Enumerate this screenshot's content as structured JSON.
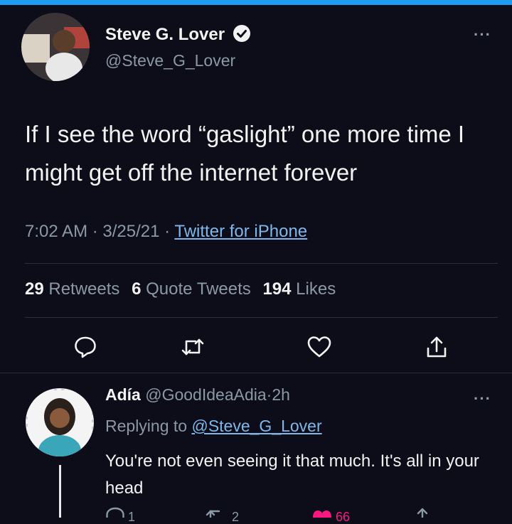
{
  "tweet": {
    "author_name": "Steve G. Lover",
    "author_handle": "@Steve_G_Lover",
    "text": "If I see the word “gaslight” one more time I might get off the internet forever",
    "time": "7:02 AM",
    "date": "3/25/21",
    "separator": "·",
    "source": "Twitter for iPhone",
    "more": "···"
  },
  "stats": {
    "retweets_count": "29",
    "retweets_label": "Retweets",
    "quotes_count": "6",
    "quotes_label": "Quote Tweets",
    "likes_count": "194",
    "likes_label": "Likes"
  },
  "reply": {
    "author_name": "Adía",
    "author_handle": "@GoodIdeaAdia",
    "separator": "·",
    "age": "2h",
    "replying_prefix": "Replying to",
    "replying_to": "@Steve_G_Lover",
    "text": "You're not even seeing it that much. It's all in your head",
    "more": "···",
    "reply_count": "1",
    "retweet_count": "2",
    "like_count": "66"
  },
  "colors": {
    "background": "#0d0d1a",
    "accent": "#1d9bf0",
    "muted": "#8b98a5",
    "text": "#f2f2f2"
  }
}
